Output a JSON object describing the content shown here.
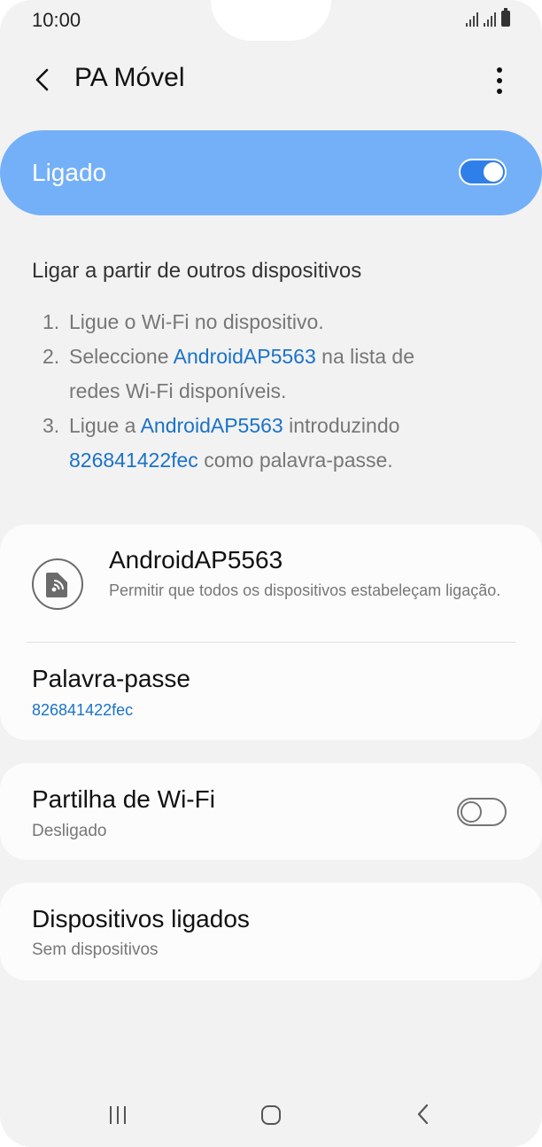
{
  "status_bar": {
    "time": "10:00"
  },
  "app_bar": {
    "title": "PA Móvel"
  },
  "master_switch": {
    "label": "Ligado",
    "state": "on",
    "color": "#74b0f8"
  },
  "instructions": {
    "title": "Ligar a partir de outros dispositivos",
    "step1": {
      "num": "1.",
      "text": "Ligue o Wi-Fi no dispositivo."
    },
    "step2": {
      "num": "2.",
      "pre": "Seleccione ",
      "link": "AndroidAP5563",
      "post": " na lista de",
      "line2": "redes Wi-Fi disponíveis."
    },
    "step3": {
      "num": "3.",
      "pre": "Ligue a ",
      "link": "AndroidAP5563",
      "post": " introduzindo",
      "link2": "826841422fec",
      "post2": " como palavra-passe."
    }
  },
  "hotspot": {
    "name": "AndroidAP5563",
    "description": "Permitir que todos os dispositivos estabeleçam ligação.",
    "icon": "hotspot-device-icon"
  },
  "password": {
    "label": "Palavra-passe",
    "value": "826841422fec"
  },
  "wifi_sharing": {
    "title": "Partilha de Wi-Fi",
    "subtitle": "Desligado",
    "state": "off"
  },
  "connected_devices": {
    "title": "Dispositivos ligados",
    "subtitle": "Sem dispositivos"
  },
  "colors": {
    "accent": "#1a73c8",
    "background": "#f2f2f2",
    "card": "#fcfcfc"
  }
}
